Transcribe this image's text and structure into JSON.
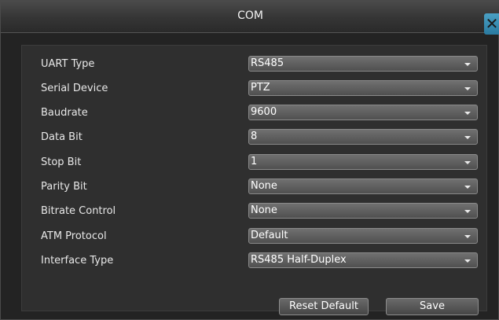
{
  "window": {
    "title": "COM",
    "close_glyph": "✕"
  },
  "fields": [
    {
      "label": "UART Type",
      "value": "RS485"
    },
    {
      "label": "Serial Device",
      "value": "PTZ"
    },
    {
      "label": "Baudrate",
      "value": "9600"
    },
    {
      "label": "Data Bit",
      "value": "8"
    },
    {
      "label": "Stop Bit",
      "value": "1"
    },
    {
      "label": "Parity Bit",
      "value": "None"
    },
    {
      "label": "Bitrate Control",
      "value": "None"
    },
    {
      "label": "ATM Protocol",
      "value": "Default"
    },
    {
      "label": "Interface Type",
      "value": "RS485 Half-Duplex"
    }
  ],
  "buttons": {
    "reset_label": "Reset Default",
    "save_label": "Save"
  },
  "colors": {
    "dialog_bg": "#232323",
    "content_bg": "#2f2f2f",
    "close_accent": "#3a8fb8"
  }
}
